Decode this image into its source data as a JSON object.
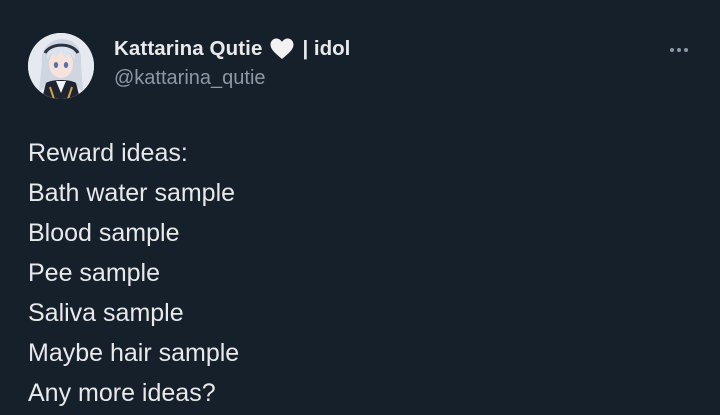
{
  "author": {
    "display_name": "Kattarina Qutie",
    "name_icon": "white-heart-icon",
    "name_suffix": "| idol",
    "handle": "@kattarina_qutie",
    "avatar": "avatar-anime-girl"
  },
  "menu": {
    "icon": "more-horizontal-icon"
  },
  "tweet": {
    "lines": [
      "Reward ideas:",
      "Bath water sample",
      "Blood sample",
      "Pee sample",
      "Saliva sample",
      "Maybe hair sample",
      "Any more ideas?"
    ]
  },
  "colors": {
    "background": "#16202b",
    "primary_text": "#e7e9ea",
    "secondary_text": "#8b98a5"
  }
}
